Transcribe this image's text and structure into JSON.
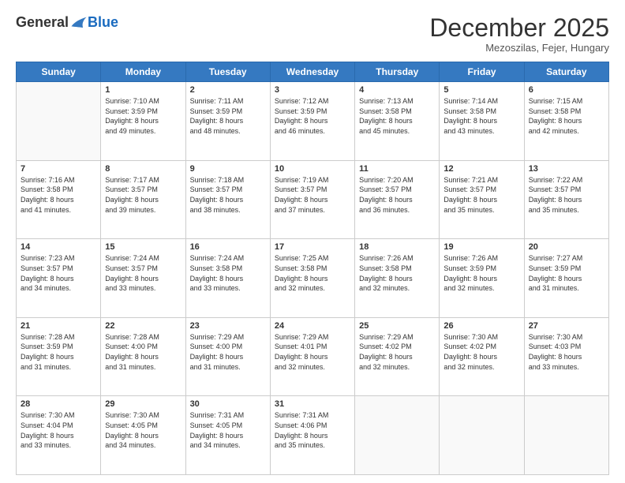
{
  "header": {
    "logo": {
      "general": "General",
      "blue": "Blue"
    },
    "title": "December 2025",
    "subtitle": "Mezoszilas, Fejer, Hungary"
  },
  "days_of_week": [
    "Sunday",
    "Monday",
    "Tuesday",
    "Wednesday",
    "Thursday",
    "Friday",
    "Saturday"
  ],
  "weeks": [
    [
      {
        "day": "",
        "info": ""
      },
      {
        "day": "1",
        "info": "Sunrise: 7:10 AM\nSunset: 3:59 PM\nDaylight: 8 hours\nand 49 minutes."
      },
      {
        "day": "2",
        "info": "Sunrise: 7:11 AM\nSunset: 3:59 PM\nDaylight: 8 hours\nand 48 minutes."
      },
      {
        "day": "3",
        "info": "Sunrise: 7:12 AM\nSunset: 3:59 PM\nDaylight: 8 hours\nand 46 minutes."
      },
      {
        "day": "4",
        "info": "Sunrise: 7:13 AM\nSunset: 3:58 PM\nDaylight: 8 hours\nand 45 minutes."
      },
      {
        "day": "5",
        "info": "Sunrise: 7:14 AM\nSunset: 3:58 PM\nDaylight: 8 hours\nand 43 minutes."
      },
      {
        "day": "6",
        "info": "Sunrise: 7:15 AM\nSunset: 3:58 PM\nDaylight: 8 hours\nand 42 minutes."
      }
    ],
    [
      {
        "day": "7",
        "info": "Sunrise: 7:16 AM\nSunset: 3:58 PM\nDaylight: 8 hours\nand 41 minutes."
      },
      {
        "day": "8",
        "info": "Sunrise: 7:17 AM\nSunset: 3:57 PM\nDaylight: 8 hours\nand 39 minutes."
      },
      {
        "day": "9",
        "info": "Sunrise: 7:18 AM\nSunset: 3:57 PM\nDaylight: 8 hours\nand 38 minutes."
      },
      {
        "day": "10",
        "info": "Sunrise: 7:19 AM\nSunset: 3:57 PM\nDaylight: 8 hours\nand 37 minutes."
      },
      {
        "day": "11",
        "info": "Sunrise: 7:20 AM\nSunset: 3:57 PM\nDaylight: 8 hours\nand 36 minutes."
      },
      {
        "day": "12",
        "info": "Sunrise: 7:21 AM\nSunset: 3:57 PM\nDaylight: 8 hours\nand 35 minutes."
      },
      {
        "day": "13",
        "info": "Sunrise: 7:22 AM\nSunset: 3:57 PM\nDaylight: 8 hours\nand 35 minutes."
      }
    ],
    [
      {
        "day": "14",
        "info": "Sunrise: 7:23 AM\nSunset: 3:57 PM\nDaylight: 8 hours\nand 34 minutes."
      },
      {
        "day": "15",
        "info": "Sunrise: 7:24 AM\nSunset: 3:57 PM\nDaylight: 8 hours\nand 33 minutes."
      },
      {
        "day": "16",
        "info": "Sunrise: 7:24 AM\nSunset: 3:58 PM\nDaylight: 8 hours\nand 33 minutes."
      },
      {
        "day": "17",
        "info": "Sunrise: 7:25 AM\nSunset: 3:58 PM\nDaylight: 8 hours\nand 32 minutes."
      },
      {
        "day": "18",
        "info": "Sunrise: 7:26 AM\nSunset: 3:58 PM\nDaylight: 8 hours\nand 32 minutes."
      },
      {
        "day": "19",
        "info": "Sunrise: 7:26 AM\nSunset: 3:59 PM\nDaylight: 8 hours\nand 32 minutes."
      },
      {
        "day": "20",
        "info": "Sunrise: 7:27 AM\nSunset: 3:59 PM\nDaylight: 8 hours\nand 31 minutes."
      }
    ],
    [
      {
        "day": "21",
        "info": "Sunrise: 7:28 AM\nSunset: 3:59 PM\nDaylight: 8 hours\nand 31 minutes."
      },
      {
        "day": "22",
        "info": "Sunrise: 7:28 AM\nSunset: 4:00 PM\nDaylight: 8 hours\nand 31 minutes."
      },
      {
        "day": "23",
        "info": "Sunrise: 7:29 AM\nSunset: 4:00 PM\nDaylight: 8 hours\nand 31 minutes."
      },
      {
        "day": "24",
        "info": "Sunrise: 7:29 AM\nSunset: 4:01 PM\nDaylight: 8 hours\nand 32 minutes."
      },
      {
        "day": "25",
        "info": "Sunrise: 7:29 AM\nSunset: 4:02 PM\nDaylight: 8 hours\nand 32 minutes."
      },
      {
        "day": "26",
        "info": "Sunrise: 7:30 AM\nSunset: 4:02 PM\nDaylight: 8 hours\nand 32 minutes."
      },
      {
        "day": "27",
        "info": "Sunrise: 7:30 AM\nSunset: 4:03 PM\nDaylight: 8 hours\nand 33 minutes."
      }
    ],
    [
      {
        "day": "28",
        "info": "Sunrise: 7:30 AM\nSunset: 4:04 PM\nDaylight: 8 hours\nand 33 minutes."
      },
      {
        "day": "29",
        "info": "Sunrise: 7:30 AM\nSunset: 4:05 PM\nDaylight: 8 hours\nand 34 minutes."
      },
      {
        "day": "30",
        "info": "Sunrise: 7:31 AM\nSunset: 4:05 PM\nDaylight: 8 hours\nand 34 minutes."
      },
      {
        "day": "31",
        "info": "Sunrise: 7:31 AM\nSunset: 4:06 PM\nDaylight: 8 hours\nand 35 minutes."
      },
      {
        "day": "",
        "info": ""
      },
      {
        "day": "",
        "info": ""
      },
      {
        "day": "",
        "info": ""
      }
    ]
  ]
}
